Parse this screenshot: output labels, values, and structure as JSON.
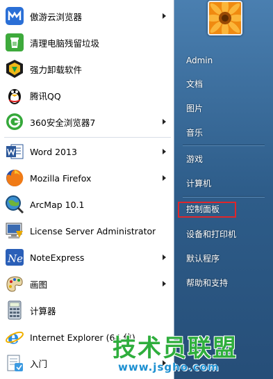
{
  "programs": [
    {
      "label": "傲游云浏览器",
      "icon": "maxthon-browser-icon",
      "submenu": true
    },
    {
      "label": "清理电脑残留垃圾",
      "icon": "recycle-bin-icon",
      "submenu": false
    },
    {
      "label": "强力卸载软件",
      "icon": "uninstaller-icon",
      "submenu": false
    },
    {
      "label": "腾讯QQ",
      "icon": "qq-penguin-icon",
      "submenu": false
    },
    {
      "label": "360安全浏览器7",
      "icon": "360-browser-icon",
      "submenu": true
    },
    {
      "label": "Word 2013",
      "icon": "word-icon",
      "submenu": true
    },
    {
      "label": "Mozilla Firefox",
      "icon": "firefox-icon",
      "submenu": true
    },
    {
      "label": "ArcMap 10.1",
      "icon": "arcmap-icon",
      "submenu": false
    },
    {
      "label": "License Server Administrator",
      "icon": "license-server-icon",
      "submenu": false
    },
    {
      "label": "NoteExpress",
      "icon": "noteexpress-icon",
      "submenu": true
    },
    {
      "label": "画图",
      "icon": "paint-icon",
      "submenu": true
    },
    {
      "label": "计算器",
      "icon": "calculator-icon",
      "submenu": false
    },
    {
      "label": "Internet Explorer (64 位)",
      "icon": "internet-explorer-icon",
      "submenu": false
    },
    {
      "label": "入门",
      "icon": "getting-started-icon",
      "submenu": true
    }
  ],
  "right_pane": {
    "user_picture": "flower-avatar-icon",
    "items": [
      {
        "label": "Admin"
      },
      {
        "label": "文档"
      },
      {
        "label": "图片"
      },
      {
        "label": "音乐"
      },
      {
        "label": "游戏"
      },
      {
        "label": "计算机"
      },
      {
        "label": "控制面板",
        "highlighted": true
      },
      {
        "label": "设备和打印机"
      },
      {
        "label": "默认程序"
      },
      {
        "label": "帮助和支持"
      }
    ]
  },
  "watermark": {
    "title": "技术员联盟",
    "url": "www.jsgho.com"
  },
  "colors": {
    "highlight_box": "#e0262a",
    "right_pane": "#2e5d8a",
    "watermark_green": "#2fae3d"
  }
}
